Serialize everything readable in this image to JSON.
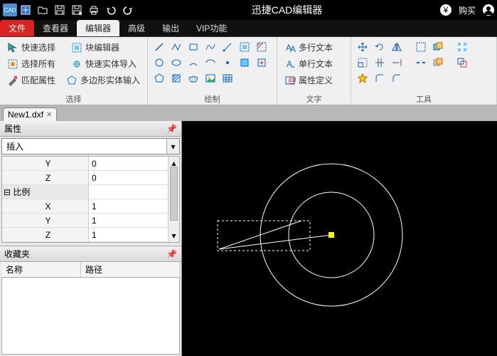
{
  "app": {
    "title": "迅捷CAD编辑器",
    "logo": "CAD",
    "buy": "购买"
  },
  "menus": {
    "file": "文件",
    "tabs": [
      "查看器",
      "编辑器",
      "高级",
      "输出",
      "VIP功能"
    ],
    "active_index": 1
  },
  "ribbon": {
    "select": {
      "label": "选择",
      "quick_select": "快速选择",
      "select_all": "选择所有",
      "match_props": "匹配属性",
      "block_editor": "块编辑器",
      "quick_entity_import": "快速实体导入",
      "polygon_entity_input": "多边形实体输入"
    },
    "draw": {
      "label": "绘制"
    },
    "text": {
      "label": "文字",
      "mtext": "多行文本",
      "stext": "单行文本",
      "attdef": "属性定义"
    },
    "tools": {
      "label": "工具"
    }
  },
  "doc": {
    "name": "New1.dxf"
  },
  "panels": {
    "props_title": "属性",
    "insert_label": "插入",
    "rows": [
      {
        "k": "Y",
        "v": "0",
        "center": true
      },
      {
        "k": "Z",
        "v": "0",
        "center": true
      },
      {
        "k": "⊟ 比例",
        "v": "",
        "group": true
      },
      {
        "k": "X",
        "v": "1",
        "center": true
      },
      {
        "k": "Y",
        "v": "1",
        "center": true
      },
      {
        "k": "Z",
        "v": "1",
        "center": true
      }
    ],
    "fav_title": "收藏夹",
    "fav_cols": {
      "name": "名称",
      "path": "路径"
    }
  }
}
